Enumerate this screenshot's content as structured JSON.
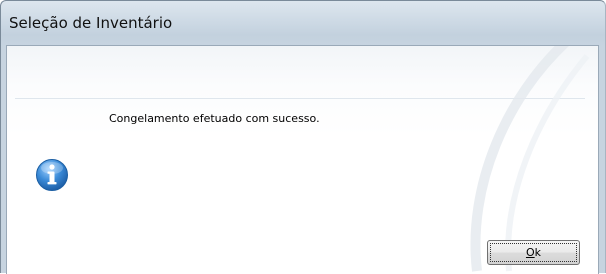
{
  "window": {
    "title": "Seleção de Inventário"
  },
  "dialog": {
    "message": "Congelamento efetuado com sucesso.",
    "icon": "info-icon",
    "ok_mnemonic": "O",
    "ok_rest": "k"
  },
  "colors": {
    "info_blue": "#3b8bd8",
    "title_text": "#111111"
  }
}
